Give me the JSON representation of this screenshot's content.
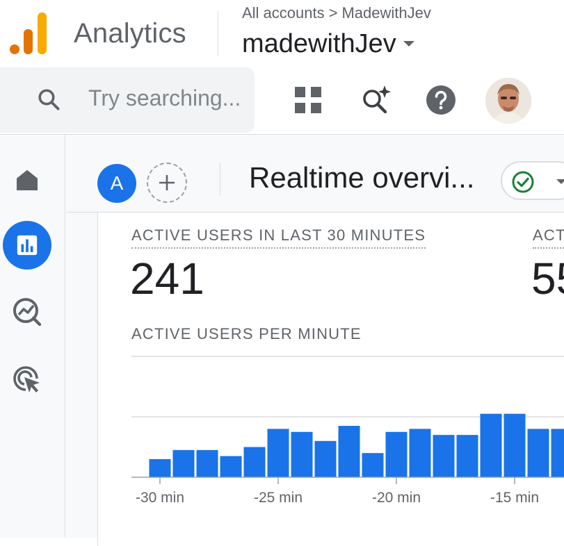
{
  "header": {
    "app_name": "Analytics",
    "breadcrumb": {
      "root": "All accounts",
      "separator": ">",
      "account_path": "MadewithJev"
    },
    "account_name": "madewithJev",
    "search_placeholder": "Try searching..."
  },
  "icons": {
    "search": "search-icon",
    "apps": "grid-icon",
    "insights": "sparkle-search-icon",
    "help": "help-icon",
    "home": "home-icon",
    "reports": "bar-chart-icon",
    "explore": "explore-icon",
    "advertising": "advertising-icon",
    "status": "check-circle-icon"
  },
  "colors": {
    "brand_blue": "#1a73e8",
    "logo_orange": "#f9ab00",
    "logo_dark_orange": "#e37400",
    "status_green": "#188038"
  },
  "toolbar": {
    "comparison_badge": "A",
    "page_title": "Realtime overvi..."
  },
  "metrics": [
    {
      "label": "ACTIVE USERS IN LAST 30 MINUTES",
      "value": "241"
    },
    {
      "label": "ACT",
      "value": "55"
    }
  ],
  "chart_data": {
    "type": "bar",
    "title": "ACTIVE USERS PER MINUTE",
    "x": [
      -30,
      -29,
      -28,
      -27,
      -26,
      -25,
      -24,
      -23,
      -22,
      -21,
      -20,
      -19,
      -18,
      -17,
      -16,
      -15,
      -14,
      -13
    ],
    "values": [
      6,
      9,
      9,
      7,
      10,
      16,
      15,
      12,
      17,
      8,
      15,
      16,
      14,
      14,
      21,
      21,
      16,
      16
    ],
    "xtick_labels": [
      "-30 min",
      "-25 min",
      "-20 min",
      "-15 min"
    ],
    "xtick_values": [
      -30,
      -25,
      -20,
      -15
    ],
    "ylim": [
      0,
      40
    ],
    "grid": true,
    "bar_color": "#1a73e8"
  }
}
